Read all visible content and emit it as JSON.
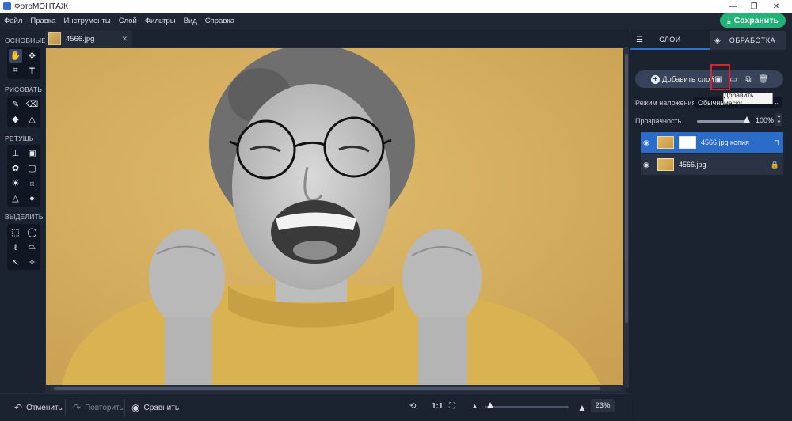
{
  "window": {
    "title": "ФотоМОНТАЖ",
    "min": "—",
    "max": "❐",
    "close": "✕"
  },
  "menu": [
    "Файл",
    "Правка",
    "Инструменты",
    "Слой",
    "Фильтры",
    "Вид",
    "Справка"
  ],
  "save_label": "Сохранить",
  "tools": {
    "sections": [
      "ОСНОВНЫЕ",
      "РИСОВАТЬ",
      "РЕТУШЬ",
      "ВЫДЕЛИТЬ"
    ]
  },
  "document_tab": {
    "name": "4566.jpg",
    "close": "✕"
  },
  "bottom": {
    "undo": "Отменить",
    "redo": "Повторить",
    "compare": "Сравнить",
    "one_to_one": "1:1",
    "zoom": "23%",
    "zoom_fraction": 0.23
  },
  "right_panel": {
    "tab_layers": "СЛОИ",
    "tab_processing": "ОБРАБОТКА",
    "add_layer": "Добавить слой",
    "tooltip": "Добавить маску",
    "blend_label": "Режим наложения:",
    "blend_value": "Обычный",
    "opacity_label": "Прозрачность",
    "opacity_value": "100%",
    "layers": [
      {
        "name": "4566.jpg копия",
        "selected": true,
        "has_mask": true
      },
      {
        "name": "4566.jpg",
        "selected": false,
        "has_mask": false
      }
    ]
  },
  "colors": {
    "accent": "#2c6cc9",
    "save": "#22b377",
    "highlight": "#e0232a",
    "photo_bg": "#d4ae61"
  }
}
